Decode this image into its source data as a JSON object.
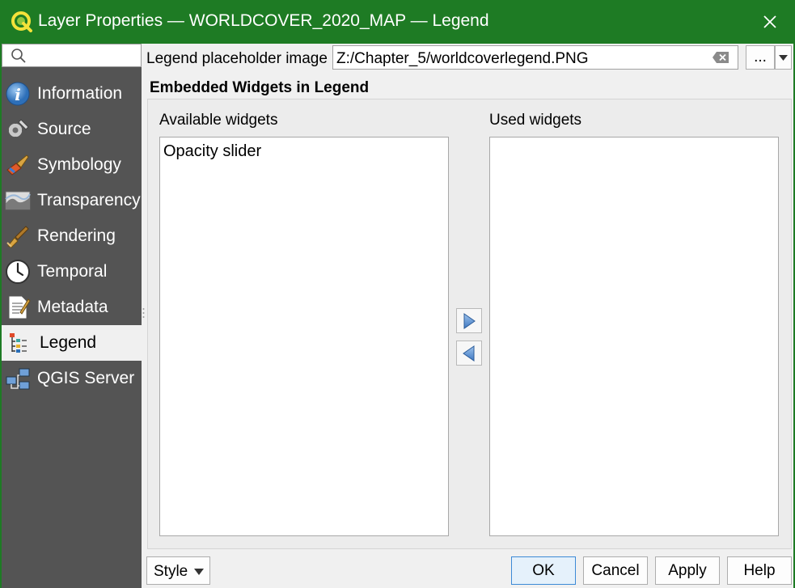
{
  "window": {
    "title": "Layer Properties — WORLDCOVER_2020_MAP — Legend",
    "close_icon": "close-icon",
    "title_bar_color": "#1e7b24"
  },
  "sidebar": {
    "background": "#545454",
    "search": {
      "value": "",
      "placeholder": ""
    },
    "items": [
      {
        "label": "Information",
        "icon": "information-icon",
        "active": false
      },
      {
        "label": "Source",
        "icon": "source-icon",
        "active": false
      },
      {
        "label": "Symbology",
        "icon": "symbology-icon",
        "active": false
      },
      {
        "label": "Transparency",
        "icon": "transparency-icon",
        "active": false
      },
      {
        "label": "Rendering",
        "icon": "rendering-icon",
        "active": false
      },
      {
        "label": "Temporal",
        "icon": "temporal-icon",
        "active": false
      },
      {
        "label": "Metadata",
        "icon": "metadata-icon",
        "active": false
      },
      {
        "label": "Legend",
        "icon": "legend-icon",
        "active": true
      },
      {
        "label": "QGIS Server",
        "icon": "qgis-server-icon",
        "active": false
      }
    ]
  },
  "legend": {
    "placeholder_label": "Legend placeholder image",
    "placeholder_value": "Z:/Chapter_5/worldcoverlegend.PNG",
    "browse_label": "...",
    "group_title": "Embedded Widgets in Legend",
    "available_label": "Available widgets",
    "used_label": "Used widgets",
    "available_items": [
      "Opacity slider"
    ],
    "used_items": []
  },
  "footer": {
    "style_label": "Style",
    "ok_label": "OK",
    "cancel_label": "Cancel",
    "apply_label": "Apply",
    "help_label": "Help"
  }
}
